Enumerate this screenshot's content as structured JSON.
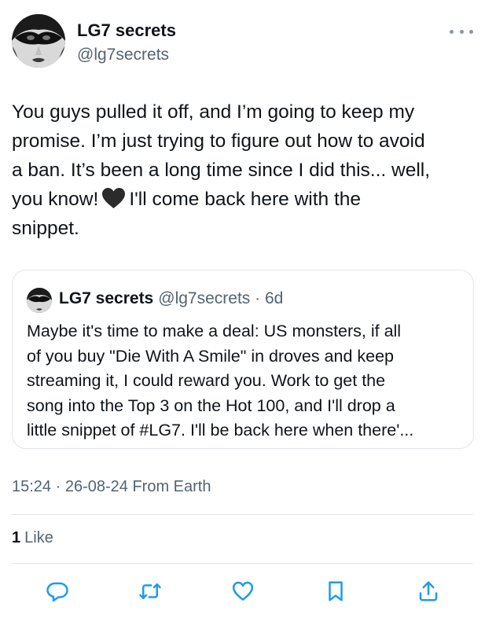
{
  "author": {
    "name": "LG7 secrets",
    "handle": "@lg7secrets"
  },
  "tweet": {
    "line1": "You guys pulled it off, and I’m going to keep my\npromise. I’m just trying to figure out how to avoid\na ban. It’s been a long time since I did this... well,\nyou know!",
    "line2": "I'll come back here with the\nsnippet.",
    "emoji": "black-heart-icon"
  },
  "quoted": {
    "name": "LG7 secrets",
    "meta": "@lg7secrets · 6d",
    "text": "Maybe it's time to make a deal: US monsters, if all\nof you buy \"Die With A Smile\" in droves and keep\nstreaming it, I could reward you. Work to get the\nsong into the Top 3 on the Hot 100, and I'll drop a\nlittle snippet of #LG7. I'll be back here when there'..."
  },
  "timestamp": "15:24 · 26-08-24 From Earth",
  "likes": {
    "count": "1",
    "label": "Like"
  },
  "actions": [
    {
      "icon": "reply-icon"
    },
    {
      "icon": "retweet-icon"
    },
    {
      "icon": "like-icon"
    },
    {
      "icon": "bookmark-icon"
    },
    {
      "icon": "share-icon"
    }
  ],
  "colors": {
    "text": "#0f1419",
    "secondary": "#536471",
    "border": "#e2e6e9",
    "action_icon": "#1d9bf0"
  }
}
